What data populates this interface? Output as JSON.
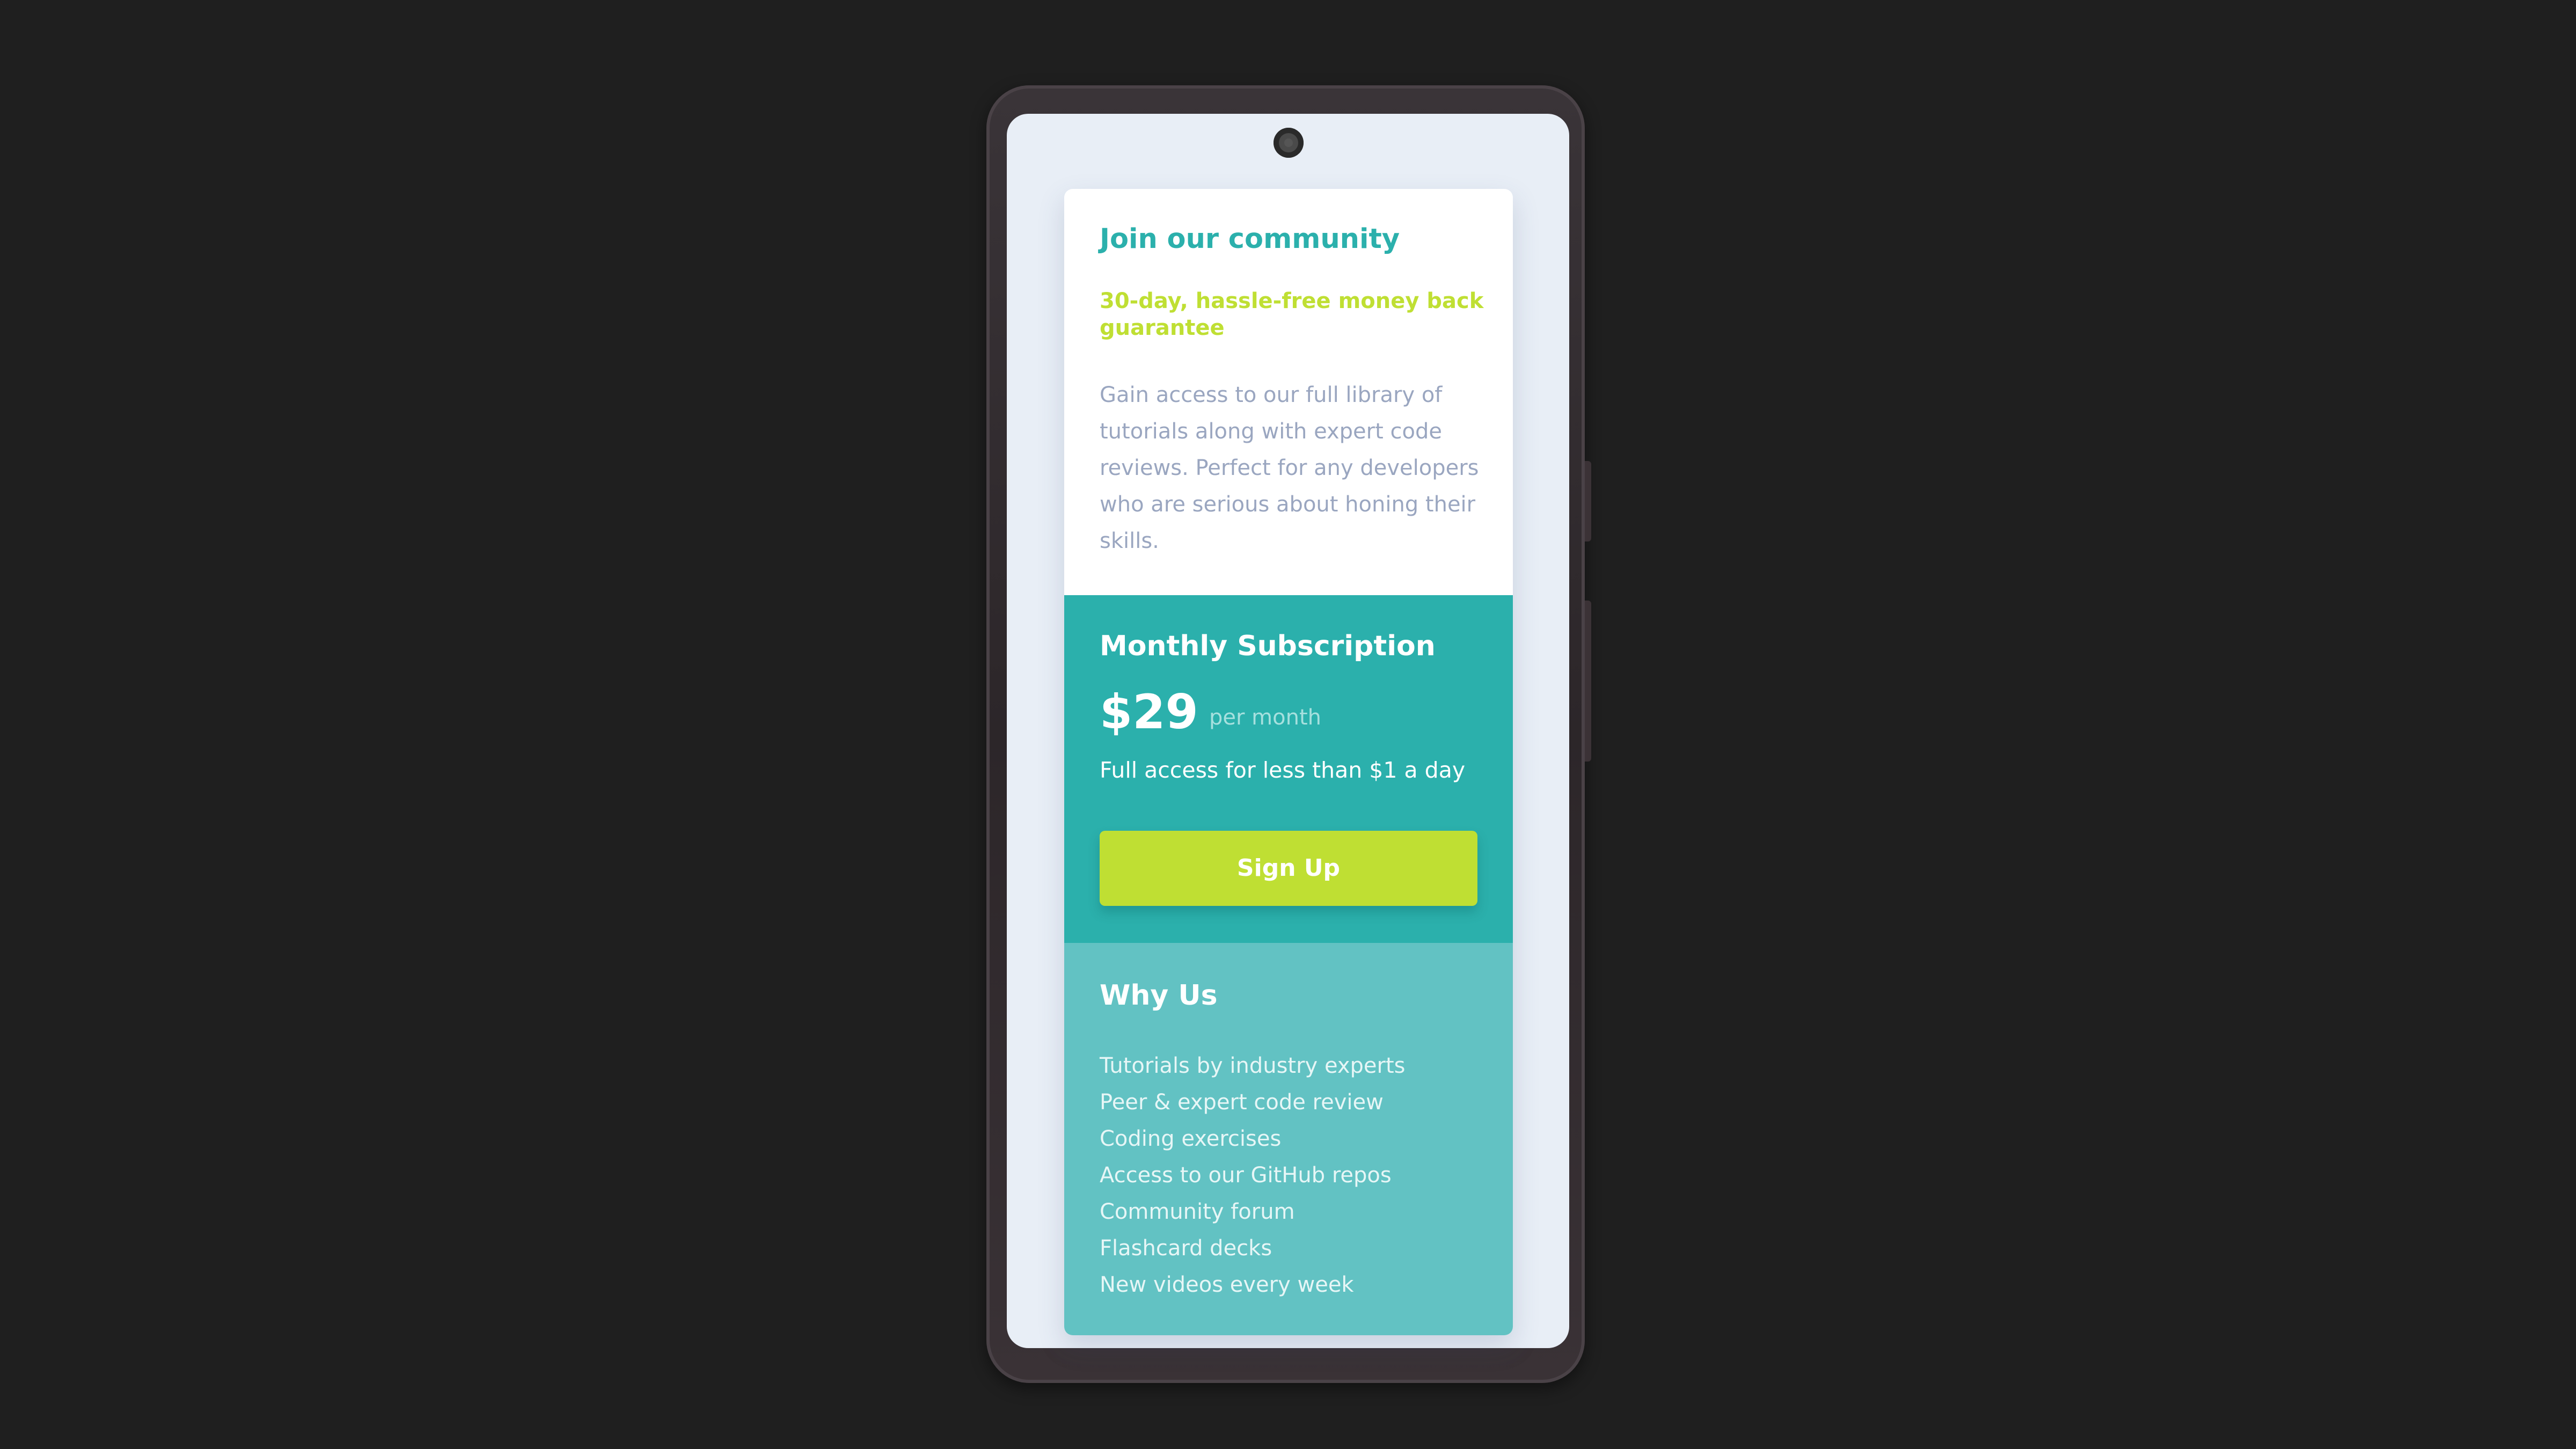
{
  "intro": {
    "title": "Join our community",
    "guarantee": "30-day, hassle-free money back guarantee",
    "description": "Gain access to our full library of tutorials along with expert code reviews. Perfect for any developers who are serious about honing their skills."
  },
  "subscription": {
    "title": "Monthly Subscription",
    "price": "$29",
    "period": "per month",
    "tagline": "Full access for less than $1 a day",
    "button_label": "Sign Up"
  },
  "why_us": {
    "title": "Why Us",
    "items": [
      "Tutorials by industry experts",
      "Peer & expert code review",
      "Coding exercises",
      "Access to our GitHub repos",
      "Community forum",
      "Flashcard decks",
      "New videos every week"
    ]
  },
  "colors": {
    "page_background": "#1f1f1f",
    "accent_teal": "#2bb0ac",
    "accent_lime": "#bfdf33",
    "light_teal": "#62c2c3",
    "muted_text": "#9aa6c0"
  }
}
